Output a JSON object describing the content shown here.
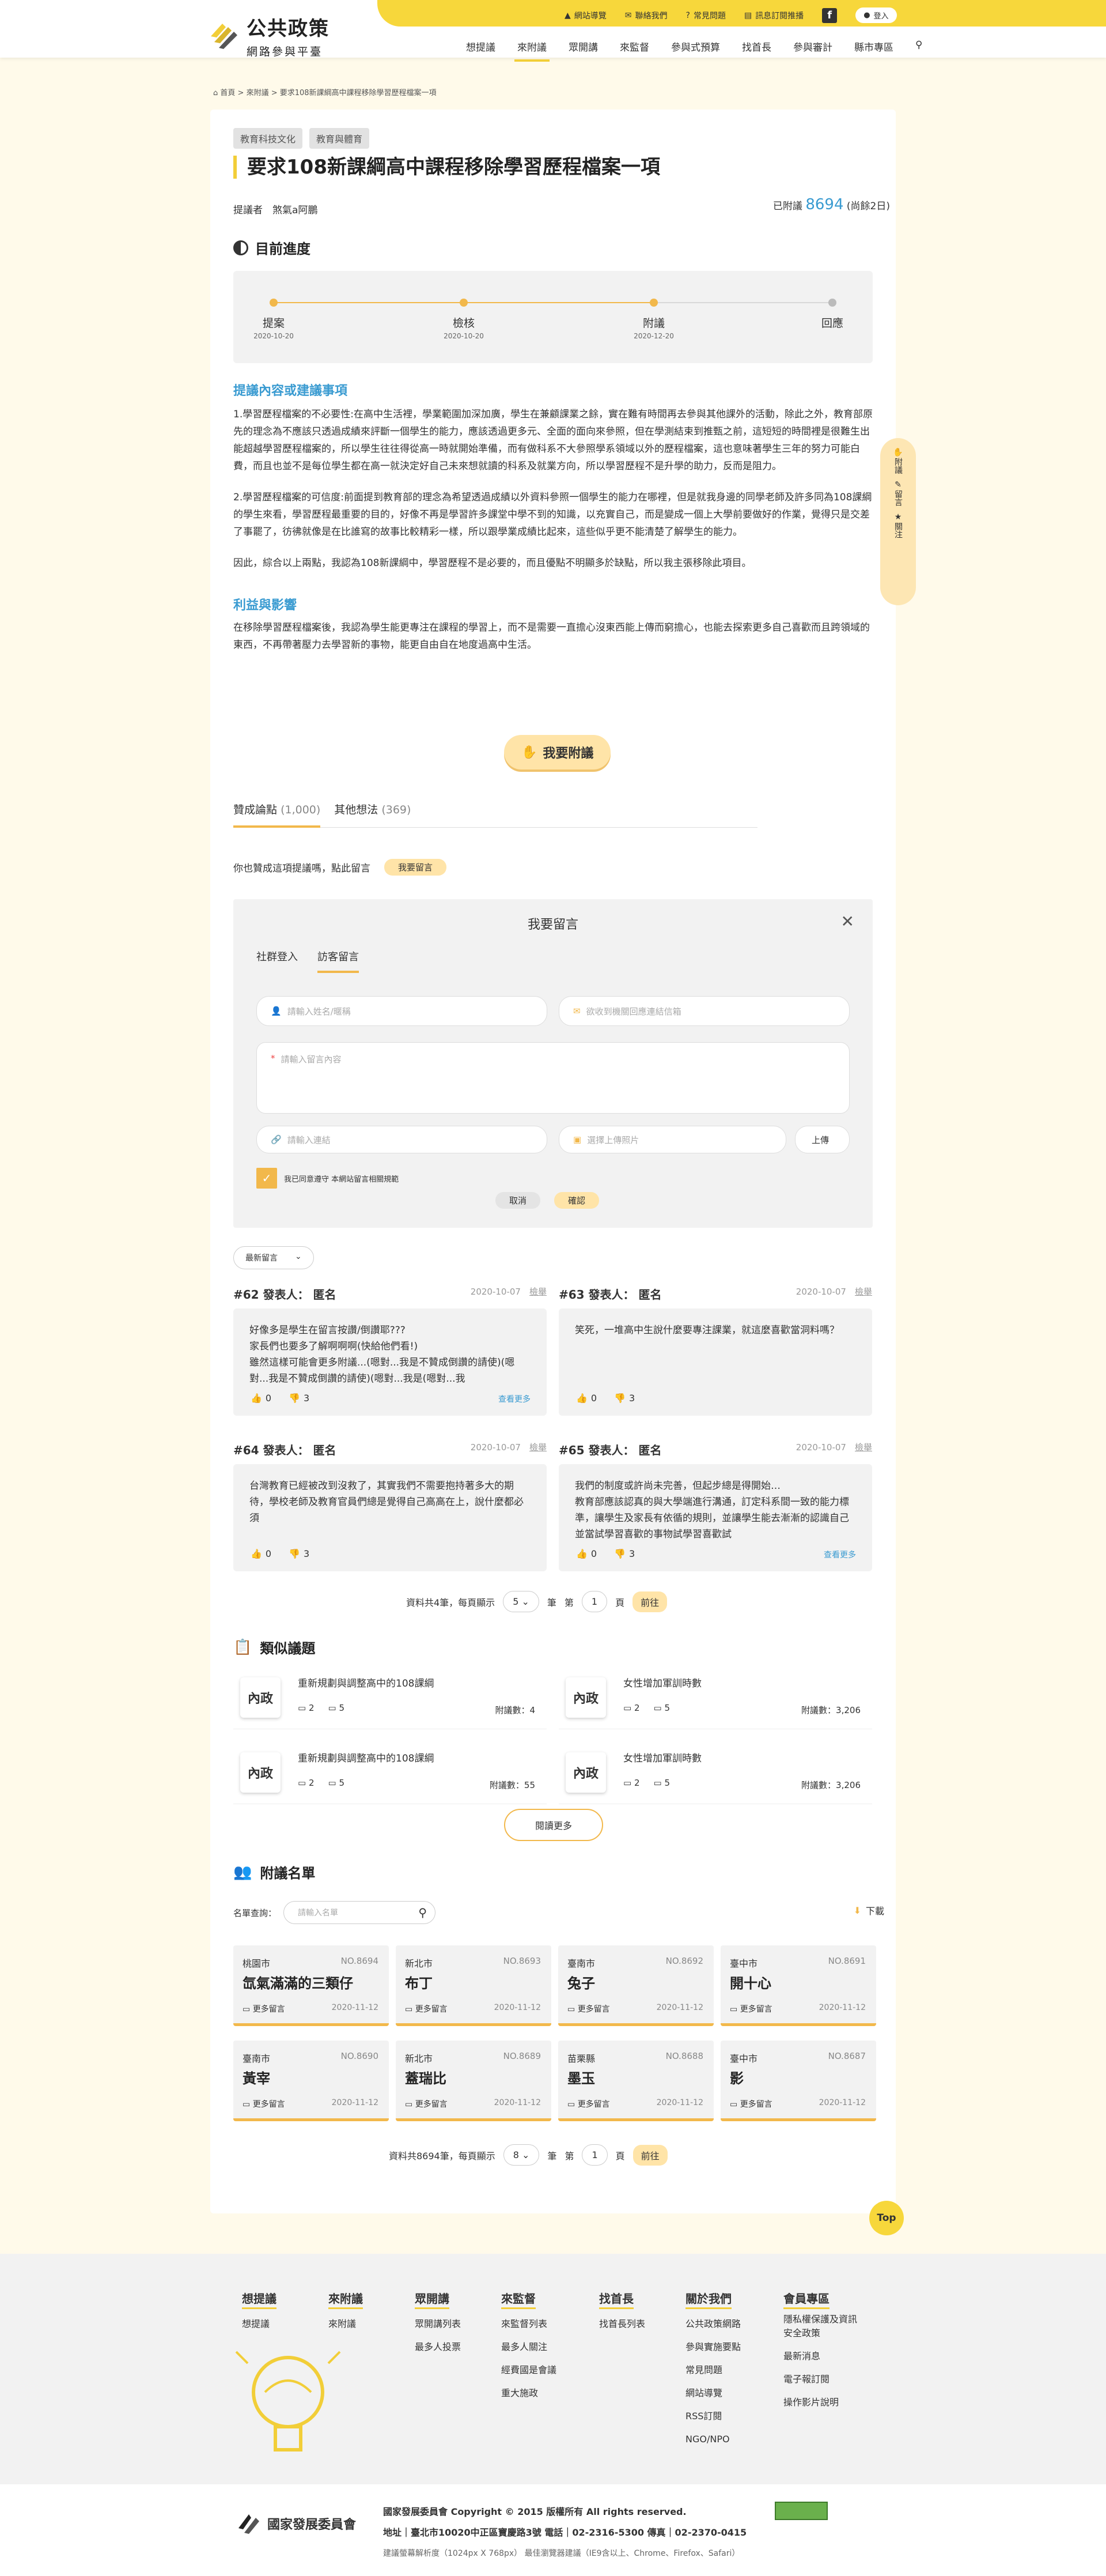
{
  "header": {
    "logo_title": "公共政策",
    "logo_subtitle": "網路參與平臺",
    "top_links": [
      "網站導覽",
      "聯絡我們",
      "常見問題",
      "訊息訂閱推播"
    ],
    "login": "登入",
    "nav": [
      "想提議",
      "來附議",
      "眾開講",
      "來監督",
      "參與式預算",
      "找首長",
      "參與審計",
      "縣市專區"
    ]
  },
  "breadcrumb": "首頁 > 來附議 > 要求108新課綱高中課程移除學習歷程檔案一項",
  "proposal": {
    "tags": [
      "教育科技文化",
      "教育與體育"
    ],
    "title": "要求108新課綱高中課程移除學習歷程檔案一項",
    "proposer_label": "提議者",
    "proposer": "煞氣a阿鵬",
    "seconded_label": "已附議",
    "seconded_count": "8694",
    "seconded_suffix": "(尚餘2日)"
  },
  "progress": {
    "title": "目前進度",
    "steps": [
      {
        "label": "提案",
        "date": "2020-10-20"
      },
      {
        "label": "檢核",
        "date": "2020-10-20"
      },
      {
        "label": "附議",
        "date": "2020-12-20"
      },
      {
        "label": "回應",
        "date": ""
      }
    ],
    "current_step": 3
  },
  "content": {
    "heading": "提議內容或建議事項",
    "p1": "1.學習歷程檔案的不必要性:在高中生活裡，學業範圍加深加廣，學生在兼顧課業之餘，實在難有時間再去參與其他課外的活動，除此之外，教育部原先的理念為不應該只透過成績來評斷一個學生的能力，應該透過更多元、全面的面向來參照，但在學測結束到推甄之前，這短短的時間裡是很難生出能超越學習歷程檔案的，所以學生往往得從高一時就開始準備，而有做科系不大參照學系領域以外的歷程檔案，這也意味著學生三年的努力可能白費，而且也並不是每位學生都在高一就決定好自己未來想就讀的科系及就業方向，所以學習歷程不是升學的助力，反而是阻力。",
    "p2": "2.學習歷程檔案的可信度:前面提到教育部的理念為希望透過成績以外資料參照一個學生的能力在哪裡，但是就我身邊的同學老師及許多同為108課綱的學生來看，學習歷程最重要的目的，好像不再是學習許多課堂中學不到的知識，以充實自己，而是變成一個上大學前要做好的作業，覺得只是交差了事罷了，彷彿就像是在比誰寫的故事比較精彩一樣，所以跟學業成績比起來，這些似乎更不能清楚了解學生的能力。",
    "p3": "因此，綜合以上兩點，我認為108新課綱中，學習歷程不是必要的，而且優點不明顯多於缺點，所以我主張移除此項目。",
    "benefit_heading": "利益與影響",
    "benefit": "在移除學習歷程檔案後，我認為學生能更專注在課程的學習上，而不是需要一直擔心沒東西能上傳而窮擔心，也能去探索更多自己喜歡而且跨領域的東西，不再帶著壓力去學習新的事物，能更自由自在地度過高中生活。",
    "second_button": "我要附議"
  },
  "side_float": [
    "附議",
    "留言",
    "關注"
  ],
  "tabs": [
    {
      "label": "贊成論點",
      "count": "(1,000)"
    },
    {
      "label": "其他想法",
      "count": "(369)"
    }
  ],
  "comment_prompt": "你也贊成這項提議嗎，點此留言",
  "comment_button": "我要留言",
  "form": {
    "title": "我要留言",
    "tabs": [
      "社群登入",
      "訪客留言"
    ],
    "name_ph": "請輸入姓名/暱稱",
    "email_ph": "欲收到機關回應連結信箱",
    "content_ph": "請輸入留言內容",
    "link_ph": "請輸入連結",
    "image_ph": "選擇上傳照片",
    "upload": "上傳",
    "agree": "我已同意遵守 本網站留言相關規範",
    "cancel": "取消",
    "confirm": "確認"
  },
  "sort": "最新留言",
  "comments": [
    {
      "no": "#62 發表人：",
      "name": "匿名",
      "date": "2020-10-07",
      "report": "檢舉",
      "text": "好像多是學生在留言按讚/倒讚耶???\n家長們也要多了解啊啊啊(快給他們看!)\n雖然這樣可能會更多附議...(嗯對...我是不贊成倒讚的請使)(嗯對...我是不贊成倒讚的請使)(嗯對...我是(嗯對...我",
      "up": "0",
      "down": "3",
      "more": "查看更多"
    },
    {
      "no": "#63 發表人：",
      "name": "匿名",
      "date": "2020-10-07",
      "report": "檢舉",
      "text": "笑死，一堆高中生說什麼要專注課業，就這麼喜歡當洞料嗎？",
      "up": "0",
      "down": "3",
      "more": ""
    },
    {
      "no": "#64 發表人：",
      "name": "匿名",
      "date": "2020-10-07",
      "report": "檢舉",
      "text": "台灣教育已經被改到沒救了，其實我們不需要抱持著多大的期待，學校老師及教育官員們總是覺得自己高高在上，說什麼都必須",
      "up": "0",
      "down": "3",
      "more": ""
    },
    {
      "no": "#65 發表人：",
      "name": "匿名",
      "date": "2020-10-07",
      "report": "檢舉",
      "text": "我們的制度或許尚未完善，但起步總是得開始…\n教育部應該認真的與大學端進行溝通，訂定科系間一致的能力標準，讓學生及家長有依循的規則，並讓學生能去漸漸的認識自己並當試學習喜歡的事物試學習喜歡試",
      "up": "0",
      "down": "3",
      "more": "查看更多"
    }
  ],
  "pagination1": {
    "total": "資料共4筆，每頁顯示",
    "per": "5",
    "unit": "筆",
    "page_pre": "第",
    "page": "1",
    "page_suf": "頁",
    "go": "前往"
  },
  "similar": {
    "title": "類似議題",
    "items": [
      {
        "cat": "內政",
        "title": "重新規劃與調整高中的108課綱",
        "c1": "2",
        "c2": "5",
        "count": "附議數：4"
      },
      {
        "cat": "內政",
        "title": "女性增加軍訓時數",
        "c1": "2",
        "c2": "5",
        "count": "附議數：3,206"
      },
      {
        "cat": "內政",
        "title": "重新規劃與調整高中的108課綱",
        "c1": "2",
        "c2": "5",
        "count": "附議數：55"
      },
      {
        "cat": "內政",
        "title": "女性增加軍訓時數",
        "c1": "2",
        "c2": "5",
        "count": "附議數：3,206"
      }
    ],
    "more": "閱讀更多"
  },
  "signers": {
    "title": "附議名單",
    "search_label": "名單查詢：",
    "search_ph": "請輸入名單",
    "download": "下載",
    "more_label": "更多留言",
    "items": [
      {
        "city": "桃園市",
        "no": "NO.8694",
        "name": "氙氣滿滿的三類仔",
        "date": "2020-11-12"
      },
      {
        "city": "新北市",
        "no": "NO.8693",
        "name": "布丁",
        "date": "2020-11-12"
      },
      {
        "city": "臺南市",
        "no": "NO.8692",
        "name": "兔子",
        "date": "2020-11-12"
      },
      {
        "city": "臺中市",
        "no": "NO.8691",
        "name": "開十心",
        "date": "2020-11-12"
      },
      {
        "city": "臺南市",
        "no": "NO.8690",
        "name": "黃宰",
        "date": "2020-11-12"
      },
      {
        "city": "新北市",
        "no": "NO.8689",
        "name": "蓋瑞比",
        "date": "2020-11-12"
      },
      {
        "city": "苗栗縣",
        "no": "NO.8688",
        "name": "墨玉",
        "date": "2020-11-12"
      },
      {
        "city": "臺中市",
        "no": "NO.8687",
        "name": "影",
        "date": "2020-11-12"
      }
    ]
  },
  "pagination2": {
    "total": "資料共8694筆，每頁顯示",
    "per": "8",
    "unit": "筆",
    "page_pre": "第",
    "page": "1",
    "page_suf": "頁",
    "go": "前往"
  },
  "top_button": "Top",
  "footer": {
    "cols": [
      {
        "h": "想提議",
        "items": [
          "想提議"
        ]
      },
      {
        "h": "來附議",
        "items": [
          "來附議"
        ]
      },
      {
        "h": "眾開講",
        "items": [
          "眾開講列表",
          "最多人投票"
        ]
      },
      {
        "h": "來監督",
        "items": [
          "來監督列表",
          "最多人關注",
          "經費國是會議",
          "重大施政"
        ]
      },
      {
        "h": "找首長",
        "items": [
          "找首長列表"
        ]
      },
      {
        "h": "關於我們",
        "items": [
          "公共政策網路",
          "參與實施要點",
          "常見問題",
          "網站導覽",
          "RSS訂閱",
          "NGO/NPO"
        ]
      },
      {
        "h": "會員專區",
        "items": [
          "隱私權保護及資訊安全政策",
          "最新消息",
          "電子報訂閱",
          "操作影片說明"
        ]
      }
    ],
    "org": "國家發展委員會",
    "copyright": "國家發展委員會 Copyright © 2015 版權所有 All rights reserved.",
    "address": "地址｜臺北市10020中正區寶慶路3號 電話｜02-2316-5300 傳真｜02-2370-0415",
    "browser": "建議螢幕解析度（1024px X 768px） 最佳瀏覽器建議（IE9含以上、Chrome、Firefox、Safari）"
  }
}
